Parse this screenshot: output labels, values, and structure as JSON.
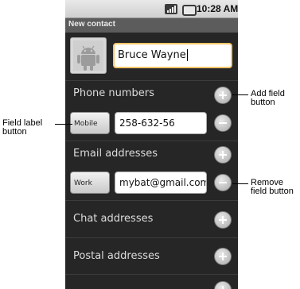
{
  "status_bar": {
    "time": "10:28 AM",
    "icons": [
      "signal-icon",
      "battery-icon"
    ]
  },
  "title_bar": {
    "title": "New contact"
  },
  "contact": {
    "photo_icon": "android-contact-photo-icon",
    "name_value": "Bruce Wayne"
  },
  "sections": {
    "phone": {
      "label": "Phone numbers",
      "field_label": "Mobile",
      "value": "258-632-56"
    },
    "email": {
      "label": "Email addresses",
      "field_label": "Work",
      "value": "mybat@gmail.com"
    },
    "chat": {
      "label": "Chat addresses"
    },
    "postal": {
      "label": "Postal addresses"
    }
  },
  "callouts": {
    "add_field": "Add field button",
    "field_label": "Field label button",
    "remove_field": "Remove field button"
  },
  "colors": {
    "phone_bg": "#262626",
    "name_focus_border": "#f5c56a",
    "title_bar": "#5c5c5c"
  }
}
